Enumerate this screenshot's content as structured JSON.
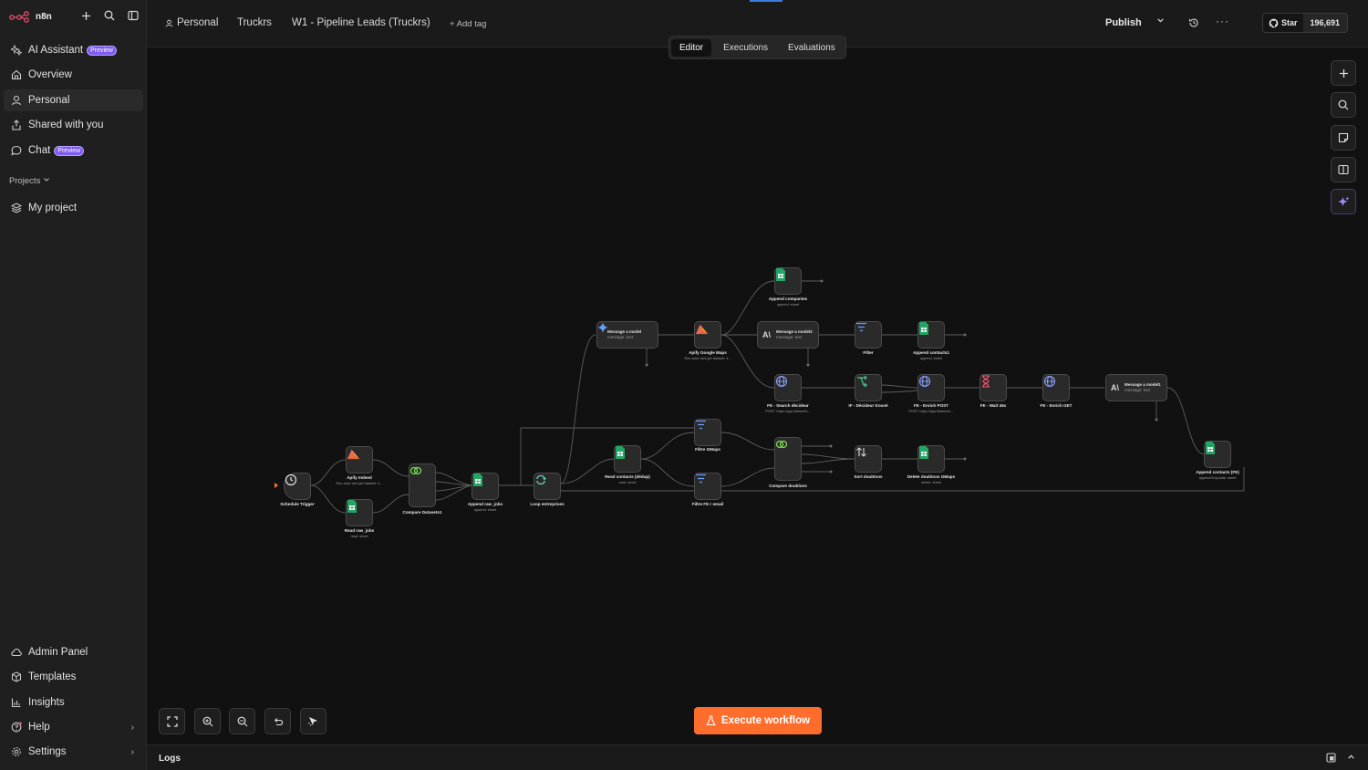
{
  "sidebar": {
    "app_name": "n8n",
    "top_items": [
      {
        "label": "AI Assistant",
        "badge": "Preview",
        "icon": "sparkles-icon"
      },
      {
        "label": "Overview",
        "icon": "home-icon"
      },
      {
        "label": "Personal",
        "icon": "user-icon"
      },
      {
        "label": "Shared with you",
        "icon": "share-icon"
      },
      {
        "label": "Chat",
        "badge": "Preview",
        "icon": "chat-icon"
      }
    ],
    "projects_label": "Projects",
    "project_items": [
      {
        "label": "My project",
        "icon": "layers-icon"
      }
    ],
    "bottom_items": [
      {
        "label": "Admin Panel",
        "icon": "cloud-icon"
      },
      {
        "label": "Templates",
        "icon": "package-icon"
      },
      {
        "label": "Insights",
        "icon": "chart-icon"
      },
      {
        "label": "Help",
        "icon": "help-icon"
      },
      {
        "label": "Settings",
        "icon": "gear-icon"
      }
    ]
  },
  "header": {
    "breadcrumb": [
      "Personal",
      "Truckrs",
      "W1 - Pipeline Leads (Truckrs)"
    ],
    "add_tag": "+ Add tag",
    "publish": "Publish",
    "github_star": "Star",
    "github_count": "196,691"
  },
  "tabs": [
    "Editor",
    "Executions",
    "Evaluations"
  ],
  "nodes": {
    "schedule": {
      "name": "Schedule Trigger",
      "sub": ""
    },
    "apify_indeed": {
      "name": "Apify Indeed",
      "sub": "Run actor and get dataset: 4..."
    },
    "read_raw_jobs": {
      "name": "Read raw_jobs",
      "sub": "read: sheet"
    },
    "compare1": {
      "name": "Compare Datasets1",
      "sub": ""
    },
    "append_raw_jobs": {
      "name": "Append raw_jobs",
      "sub": "append: sheet"
    },
    "loop": {
      "name": "Loop entreprises",
      "sub": ""
    },
    "message_model": {
      "name": "Message a model",
      "sub": "message: text"
    },
    "apify_gmaps": {
      "name": "Apify Google Maps",
      "sub": "Run actor and get dataset: 4..."
    },
    "append_companies": {
      "name": "Append companies",
      "sub": "append: sheet"
    },
    "message_model2": {
      "name": "Message a model2",
      "sub": "message: text"
    },
    "filter": {
      "name": "Filter",
      "sub": ""
    },
    "append_contacts1": {
      "name": "Append contacts1",
      "sub": "append: sheet"
    },
    "fe_search": {
      "name": "FE - Search décideur",
      "sub": "POST: https://app.fullenrich..."
    },
    "if_decideur": {
      "name": "IF - Décideur trouvé",
      "sub": ""
    },
    "fe_enrich_post": {
      "name": "FE - Enrich POST",
      "sub": "POST: https://app.fullenrich..."
    },
    "fe_wait": {
      "name": "FE - Wait 45s",
      "sub": ""
    },
    "fe_enrich_get": {
      "name": "FE - Enrich GET",
      "sub": ""
    },
    "message_model1": {
      "name": "Message a model1",
      "sub": "message: text"
    },
    "append_contacts_fe": {
      "name": "Append contacts (FE)",
      "sub": "appendOrUpdate: sheet"
    },
    "read_contacts": {
      "name": "Read contacts (dédup)",
      "sub": "read: sheet"
    },
    "filtre_gmaps": {
      "name": "Filtre GMaps",
      "sub": ""
    },
    "filtre_fe": {
      "name": "Filtre FE r email",
      "sub": ""
    },
    "compare_doublons": {
      "name": "Compare doublons",
      "sub": ""
    },
    "sort_doublons": {
      "name": "Sort doublons",
      "sub": ""
    },
    "delete_doublons": {
      "name": "Delete doublons GMaps",
      "sub": "delete: sheet"
    }
  },
  "execute_button": "Execute workflow",
  "logs_label": "Logs",
  "colors": {
    "accent": "#ff6d2d",
    "sheets_green": "#22a565",
    "badge_purple": "#7d5bf0"
  }
}
